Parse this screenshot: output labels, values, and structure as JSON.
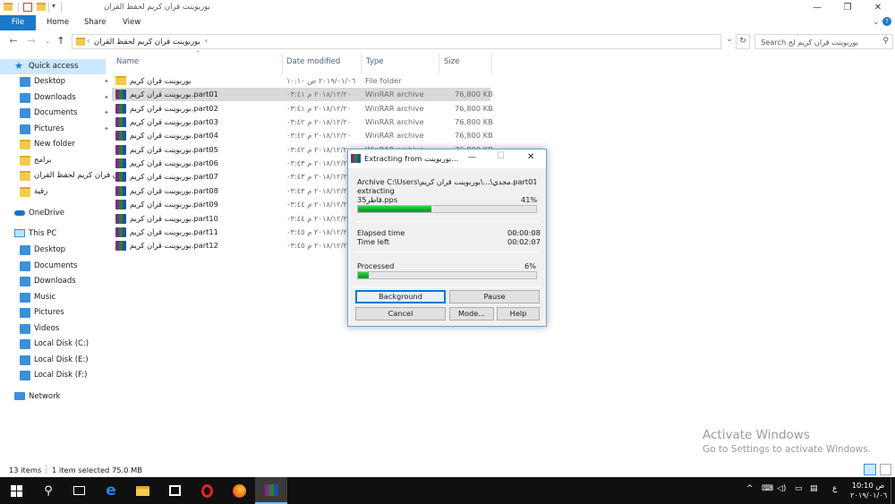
{
  "window": {
    "title": "بوربوينت قران كريم لحفظ القران",
    "controls": {
      "minimize": "—",
      "maximize": "❐",
      "close": "✕"
    }
  },
  "ribbon": {
    "tabs": [
      "File",
      "Home",
      "Share",
      "View"
    ]
  },
  "address": {
    "path": "بوربوينت قران كريم لحفظ القران",
    "search_placeholder": "Search بوربوينت قران كريم لح"
  },
  "nav": {
    "quick_access": "Quick access",
    "quick_items": [
      "Desktop",
      "Downloads",
      "Documents",
      "Pictures",
      "New folder",
      "برامج",
      "ن قران كريم لحفظ القران",
      "رقية"
    ],
    "onedrive": "OneDrive",
    "this_pc": "This PC",
    "pc_items": [
      "Desktop",
      "Documents",
      "Downloads",
      "Music",
      "Pictures",
      "Videos",
      "Local Disk (C:)",
      "Local Disk (E:)",
      "Local Disk (F:)"
    ],
    "network": "Network"
  },
  "columns": {
    "name": "Name",
    "date": "Date modified",
    "type": "Type",
    "size": "Size"
  },
  "files": [
    {
      "name": "بوربوينت قران كريم",
      "date": "٢٠١٩/٠١/٠٦ ص ١٠:١٠",
      "type": "File folder",
      "size": "",
      "kind": "folder"
    },
    {
      "name": "بوربوينت قران كريم.part01",
      "date": "٢٠١٨/١٢/٢٠ م ٠٣:٤١",
      "type": "WinRAR archive",
      "size": "76,800 KB",
      "kind": "rar",
      "selected": true
    },
    {
      "name": "بوربوينت قران كريم.part02",
      "date": "٢٠١٨/١٢/٢٠ م ٠٣:٤١",
      "type": "WinRAR archive",
      "size": "76,800 KB",
      "kind": "rar"
    },
    {
      "name": "بوربوينت قران كريم.part03",
      "date": "٢٠١٨/١٢/٢٠ م ٠٣:٤٢",
      "type": "WinRAR archive",
      "size": "76,800 KB",
      "kind": "rar"
    },
    {
      "name": "بوربوينت قران كريم.part04",
      "date": "٢٠١٨/١٢/٢٠ م ٠٣:٤٢",
      "type": "WinRAR archive",
      "size": "76,800 KB",
      "kind": "rar"
    },
    {
      "name": "بوربوينت قران كريم.part05",
      "date": "٢٠١٨/١٢/٢٠ م ٠٣:٤٢",
      "type": "WinRAR archive",
      "size": "76,800 KB",
      "kind": "rar"
    },
    {
      "name": "بوربوينت قران كريم.part06",
      "date": "٢٠١٨/١٢/٢٠ م ٠٣:٤٣",
      "type": "",
      "size": "",
      "kind": "rar"
    },
    {
      "name": "بوربوينت قران كريم.part07",
      "date": "٢٠١٨/١٢/٢٠ م ٠٣:٤٣",
      "type": "",
      "size": "",
      "kind": "rar"
    },
    {
      "name": "بوربوينت قران كريم.part08",
      "date": "٢٠١٨/١٢/٢٠ م ٠٣:٤٣",
      "type": "",
      "size": "",
      "kind": "rar"
    },
    {
      "name": "بوربوينت قران كريم.part09",
      "date": "٢٠١٨/١٢/٢٠ م ٠٣:٤٤",
      "type": "",
      "size": "",
      "kind": "rar"
    },
    {
      "name": "بوربوينت قران كريم.part10",
      "date": "٢٠١٨/١٢/٢٠ م ٠٣:٤٤",
      "type": "",
      "size": "",
      "kind": "rar"
    },
    {
      "name": "بوربوينت قران كريم.part11",
      "date": "٢٠١٨/١٢/٢٠ م ٠٣:٤٥",
      "type": "",
      "size": "",
      "kind": "rar"
    },
    {
      "name": "بوربوينت قران كريم.part12",
      "date": "٢٠١٨/١٢/٢٠ م ٠٣:٤٥",
      "type": "",
      "size": "",
      "kind": "rar"
    }
  ],
  "dialog": {
    "title": "Extracting from بوربوينت...",
    "archive_line": "Archive C:\\Users\\مجدي\\...\\بوربوينت قران كريم.part01.rar",
    "extracting_label": "extracting",
    "current_file": "قاطر35.pps",
    "file_progress_text": "41%",
    "file_progress": 0.41,
    "elapsed_label": "Elapsed time",
    "elapsed_value": "00:00:08",
    "left_label": "Time left",
    "left_value": "00:02:07",
    "processed_label": "Processed",
    "processed_text": "6%",
    "processed_progress": 0.06,
    "buttons": {
      "background": "Background",
      "pause": "Pause",
      "cancel": "Cancel",
      "mode": "Mode...",
      "help": "Help"
    }
  },
  "status": {
    "items": "13 items",
    "selected": "1 item selected  75.0 MB"
  },
  "watermark": {
    "line1": "Activate Windows",
    "line2": "Go to Settings to activate Windows."
  },
  "taskbar": {
    "clock_time": "10:10 ص",
    "clock_date": "٢٠١٩/٠١/٠٦",
    "language": "ع"
  },
  "colors": {
    "accent": "#1979ca",
    "selection": "#d9d9d9",
    "progress": "#06b025",
    "taskbar": "#101010"
  }
}
